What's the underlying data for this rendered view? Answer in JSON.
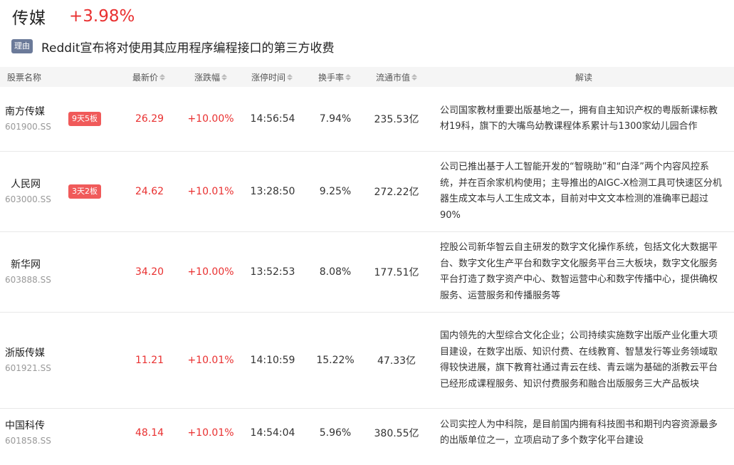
{
  "sector": {
    "name": "传媒",
    "change": "+3.98%"
  },
  "reason": {
    "badge": "理由",
    "text": "Reddit宣布将对使用其应用程序编程接口的第三方收费"
  },
  "columns": {
    "name": "股票名称",
    "price": "最新价",
    "change": "涨跌幅",
    "limit_time": "涨停时间",
    "turnover": "换手率",
    "float_cap": "流通市值",
    "analysis": "解读"
  },
  "rows": [
    {
      "name": "南方传媒",
      "code": "601900.SS",
      "streak": "9天5板",
      "price": "26.29",
      "change": "+10.00%",
      "limit_time": "14:56:54",
      "turnover": "7.94%",
      "float_cap": "235.53亿",
      "analysis": "公司国家教材重要出版基地之一，拥有自主知识产权的粤版新课标教材19科，旗下的大嘴鸟幼教课程体系累计与1300家幼儿园合作"
    },
    {
      "name": "人民网",
      "code": "603000.SS",
      "streak": "3天2板",
      "price": "24.62",
      "change": "+10.01%",
      "limit_time": "13:28:50",
      "turnover": "9.25%",
      "float_cap": "272.22亿",
      "analysis": "公司已推出基于人工智能开发的“智晓助”和“白泽”两个内容风控系统，并在百余家机构使用；主导推出的AIGC-X检测工具可快速区分机器生成文本与人工生成文本，目前对中文文本检测的准确率已超过90%"
    },
    {
      "name": "新华网",
      "code": "603888.SS",
      "streak": "",
      "price": "34.20",
      "change": "+10.00%",
      "limit_time": "13:52:53",
      "turnover": "8.08%",
      "float_cap": "177.51亿",
      "analysis": "控股公司新华智云自主研发的数字文化操作系统，包括文化大数据平台、数字文化生产平台和数字文化服务平台三大板块，数字文化服务平台打造了数字资产中心、数智运营中心和数字传播中心，提供确权服务、运营服务和传播服务等"
    },
    {
      "name": "浙版传媒",
      "code": "601921.SS",
      "streak": "",
      "price": "11.21",
      "change": "+10.01%",
      "limit_time": "14:10:59",
      "turnover": "15.22%",
      "float_cap": "47.33亿",
      "analysis": "国内领先的大型综合文化企业；公司持续实施数字出版产业化重大项目建设，在数字出版、知识付费、在线教育、智慧发行等业务领域取得较快进展，旗下教育社通过青云在线、青云端为基础的浙教云平台已经形成课程服务、知识付费服务和融合出版服务三大产品板块"
    },
    {
      "name": "中国科传",
      "code": "601858.SS",
      "streak": "",
      "price": "48.14",
      "change": "+10.01%",
      "limit_time": "14:54:04",
      "turnover": "5.96%",
      "float_cap": "380.55亿",
      "analysis": "公司实控人为中科院，是目前国内拥有科技图书和期刊内容资源最多的出版单位之一，立项启动了多个数字化平台建设"
    }
  ]
}
